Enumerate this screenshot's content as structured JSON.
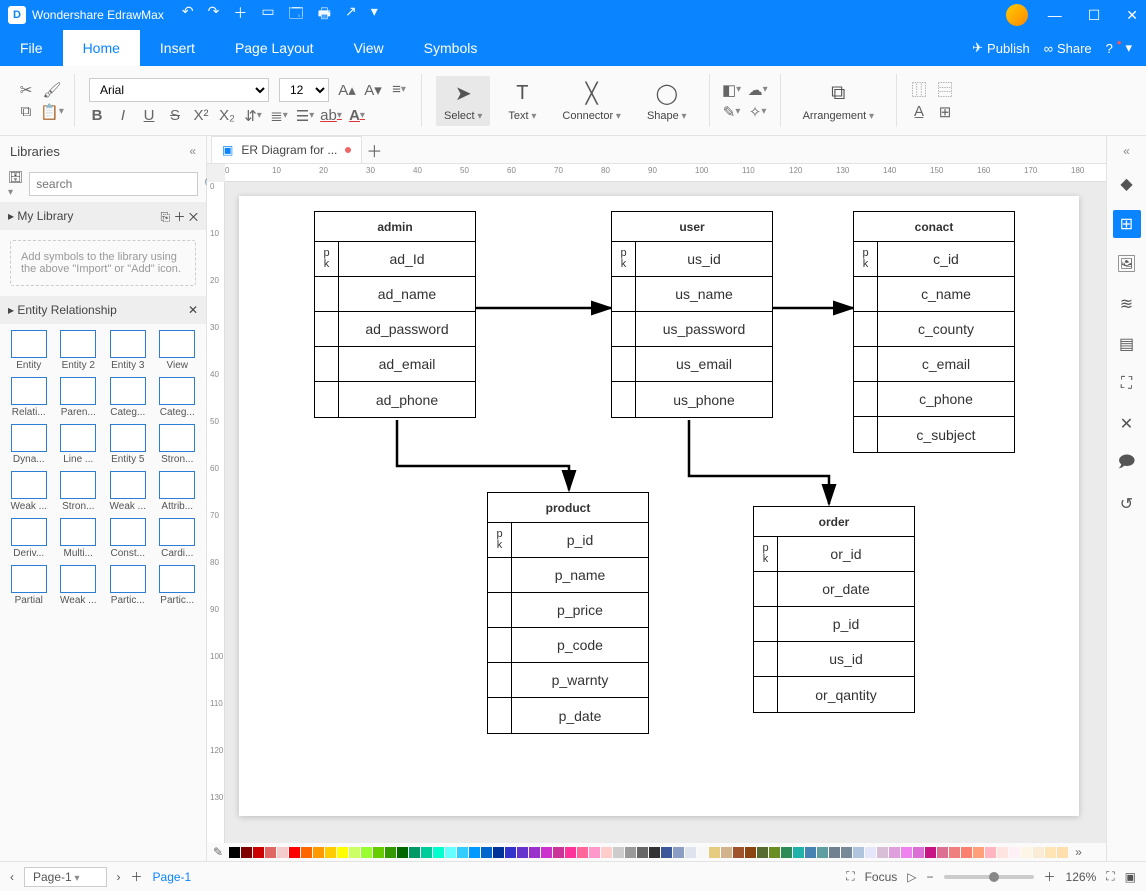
{
  "app": {
    "title": "Wondershare EdrawMax"
  },
  "quick": [
    "↶",
    "↷",
    "＋",
    "▭",
    "🗔",
    "🖶",
    "↗",
    "▾"
  ],
  "menu": {
    "tabs": [
      "File",
      "Home",
      "Insert",
      "Page Layout",
      "View",
      "Symbols"
    ],
    "active": 1,
    "publish": "Publish",
    "share": "Share"
  },
  "ribbon": {
    "font": "Arial",
    "size": "12",
    "select": "Select",
    "text": "Text",
    "connector": "Connector",
    "shape": "Shape",
    "arrangement": "Arrangement"
  },
  "libraries": {
    "title": "Libraries",
    "search_ph": "search",
    "mylib": "My Library",
    "hint": "Add symbols to the library using the above \"Import\" or \"Add\" icon.",
    "section": "Entity Relationship",
    "shapes": [
      "Entity",
      "Entity 2",
      "Entity 3",
      "View",
      "Relati...",
      "Paren...",
      "Categ...",
      "Categ...",
      "Dyna...",
      "Line ...",
      "Entity 5",
      "Stron...",
      "Weak ...",
      "Stron...",
      "Weak ...",
      "Attrib...",
      "Deriv...",
      "Multi...",
      "Const...",
      "Cardi...",
      "Partial",
      "Weak ...",
      "Partic...",
      "Partic..."
    ]
  },
  "doc": {
    "tab": "ER Diagram for ..."
  },
  "palette": [
    "#000000",
    "#7f0000",
    "#cc0000",
    "#e06666",
    "#f4cccc",
    "#ff0000",
    "#ff6600",
    "#ff9900",
    "#ffcc00",
    "#ffff00",
    "#ccff66",
    "#99ff33",
    "#66cc00",
    "#339900",
    "#006600",
    "#009966",
    "#00cc99",
    "#00ffcc",
    "#66ffff",
    "#33ccff",
    "#0099ff",
    "#0066cc",
    "#003399",
    "#3333cc",
    "#6633cc",
    "#9933cc",
    "#cc33cc",
    "#cc3399",
    "#ff3399",
    "#ff6699",
    "#ff99cc",
    "#ffcccc",
    "#cccccc",
    "#999999",
    "#666666",
    "#333333",
    "#3b5998",
    "#8b9dc3",
    "#dfe3ee",
    "#f7f7f7",
    "#e6cc80",
    "#d2b48c",
    "#a0522d",
    "#8b4513",
    "#556b2f",
    "#6b8e23",
    "#2e8b57",
    "#20b2aa",
    "#4682b4",
    "#5f9ea0",
    "#708090",
    "#778899",
    "#b0c4de",
    "#e6e6fa",
    "#d8bfd8",
    "#dda0dd",
    "#ee82ee",
    "#da70d6",
    "#c71585",
    "#db7093",
    "#f08080",
    "#fa8072",
    "#ffa07a",
    "#ffb6c1",
    "#ffe4e1",
    "#fff0f5",
    "#fdf5e6",
    "#faebd7",
    "#ffe4b5",
    "#ffdead"
  ],
  "tables": {
    "admin": {
      "title": "admin",
      "pk": "p k",
      "rows": [
        "ad_Id",
        "ad_name",
        "ad_password",
        "ad_email",
        "ad_phone"
      ]
    },
    "user": {
      "title": "user",
      "pk": "p k",
      "rows": [
        "us_id",
        "us_name",
        "us_password",
        "us_email",
        "us_phone"
      ]
    },
    "conact": {
      "title": "conact",
      "pk": "p k",
      "rows": [
        "c_id",
        "c_name",
        "c_county",
        "c_email",
        "c_phone",
        "c_subject"
      ]
    },
    "product": {
      "title": "product",
      "pk": "p k",
      "rows": [
        "p_id",
        "p_name",
        "p_price",
        "p_code",
        "p_warnty",
        "p_date"
      ]
    },
    "order": {
      "title": "order",
      "pk": "p k",
      "rows": [
        "or_id",
        "or_date",
        "p_id",
        "us_id",
        "or_qantity"
      ]
    }
  },
  "status": {
    "page": "Page-1",
    "page_link": "Page-1",
    "focus": "Focus",
    "zoom": "126%"
  }
}
